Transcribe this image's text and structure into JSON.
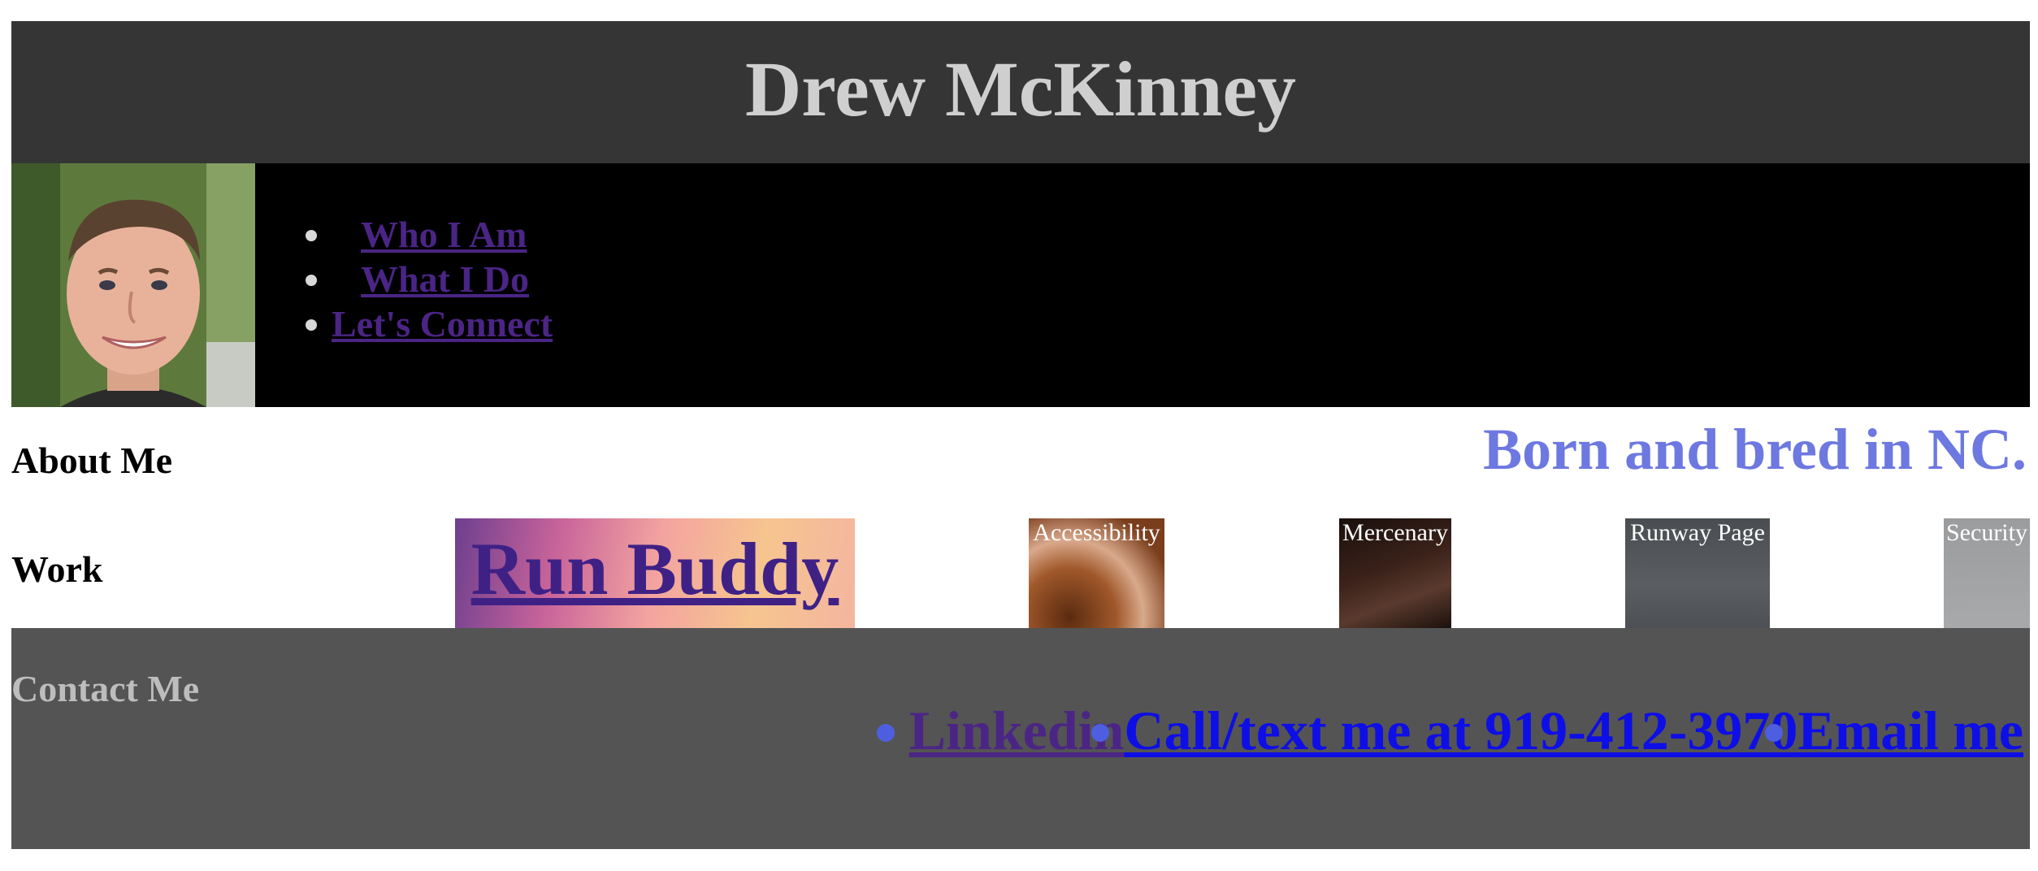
{
  "header": {
    "title": "Drew McKinney"
  },
  "nav": {
    "portrait_alt": "portrait",
    "items": [
      {
        "label": "Who I Am"
      },
      {
        "label": "What I Do"
      },
      {
        "label": "Let's Connect"
      }
    ]
  },
  "about": {
    "heading": "About Me",
    "text": "Born and bred in NC."
  },
  "work": {
    "heading": "Work",
    "projects": [
      {
        "label": "Run Buddy"
      },
      {
        "label": "Accessibility"
      },
      {
        "label": "Mercenary"
      },
      {
        "label": "Runway Page"
      },
      {
        "label": "Security"
      }
    ]
  },
  "contact": {
    "heading": "Contact Me",
    "links": [
      {
        "label": "Linkedin"
      },
      {
        "label": "Call/text me at 919-412-3970"
      },
      {
        "label": "Email me"
      }
    ]
  },
  "colors": {
    "header_bg": "#353535",
    "nav_bg": "#000000",
    "link_visited": "#4b2585",
    "link": "#0e0ee6",
    "accent": "#6d78e0",
    "footer_bg": "#545454"
  }
}
